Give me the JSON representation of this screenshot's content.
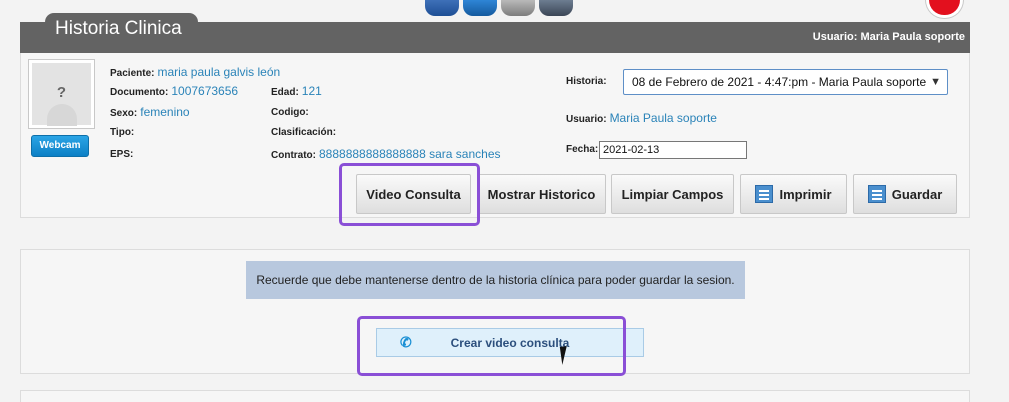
{
  "header": {
    "title": "Historia Clinica",
    "user_label": "Usuario: Maria Paula soporte"
  },
  "toolbar_icons": [
    "back-icon",
    "users-icon",
    "print-icon",
    "stack-icon"
  ],
  "patient": {
    "photo_placeholder": "?",
    "webcam_label": "Webcam",
    "paciente_label": "Paciente:",
    "paciente_value": "maria paula galvis león",
    "documento_label": "Documento:",
    "documento_value": "1007673656",
    "edad_label": "Edad:",
    "edad_value": "121",
    "sexo_label": "Sexo:",
    "sexo_value": "femenino",
    "codigo_label": "Codigo:",
    "tipo_label": "Tipo:",
    "clasificacion_label": "Clasificación:",
    "eps_label": "EPS:",
    "contrato_label": "Contrato:",
    "contrato_value": "8888888888888888 sara sanches"
  },
  "session": {
    "historia_label": "Historia:",
    "historia_selected": "08 de Febrero de 2021 - 4:47:pm - Maria Paula soporte",
    "usuario_label": "Usuario:",
    "usuario_value": "Maria Paula soporte",
    "fecha_label": "Fecha:",
    "fecha_value": "2021-02-13"
  },
  "actions": {
    "video_consulta": "Video Consulta",
    "mostrar_historico": "Mostrar Historico",
    "limpiar_campos": "Limpiar Campos",
    "imprimir": "Imprimir",
    "guardar": "Guardar"
  },
  "video": {
    "notice": "Recuerde que debe mantenerse dentro de la historia clínica para poder guardar la sesion.",
    "create_label": "Crear video consulta"
  },
  "colors": {
    "header_bg": "#636363",
    "link_blue": "#2a83b8",
    "highlight": "#8a4fd6",
    "notice_bg": "#b8c8de",
    "create_bg": "#dff0fb"
  }
}
